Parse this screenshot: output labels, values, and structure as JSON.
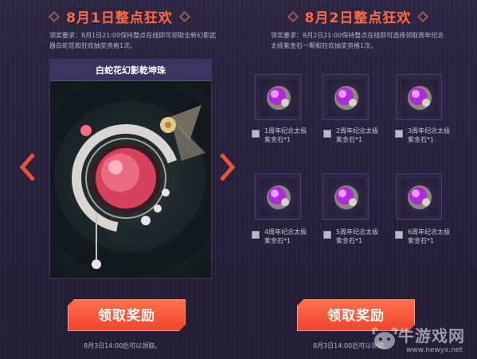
{
  "day1": {
    "title": "8月1日整点狂欢",
    "requirement": "领奖要求：8月1日21:00保持整点在线即可领取全新幻影武器白蛇花和狂欢抽奖资格1次。",
    "showcase_title": "白蛇花幻影乾坤珠",
    "button_label": "领取奖励",
    "note": "8月3日14:00后可以领取。"
  },
  "day2": {
    "title": "8月2日整点狂欢",
    "requirement": "领奖要求：8月2日21:00保持整点在线即可选择领取周年纪念太极紫金石一颗和狂欢抽奖资格1次。",
    "items": [
      {
        "line1": "1周年纪念太极",
        "line2": "紫金石*1"
      },
      {
        "line1": "2周年纪念太极",
        "line2": "紫金石*1"
      },
      {
        "line1": "3周年纪念太极",
        "line2": "紫金石*1"
      },
      {
        "line1": "4周年纪念太极",
        "line2": "紫金石*1"
      },
      {
        "line1": "5周年纪念太极",
        "line2": "紫金石*1"
      },
      {
        "line1": "6周年纪念太极",
        "line2": "紫金石*1"
      }
    ],
    "button_label": "领取奖励",
    "note": "8月3日14:00后可以领取。"
  },
  "watermark": {
    "text": "牛游戏网",
    "url": "www.newyx.net"
  },
  "colors": {
    "accent": "#ff6b3d",
    "button": "#f0452c",
    "background": "#2a2340"
  },
  "icons": {
    "prev": "chevron-left-icon",
    "next": "chevron-right-icon",
    "item": "purple-gem-icon"
  }
}
